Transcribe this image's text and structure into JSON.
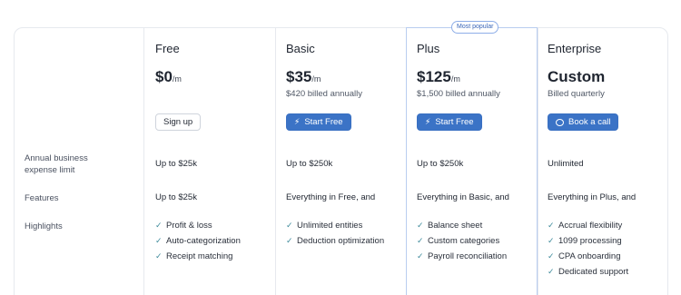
{
  "badge": "Most popular",
  "plans": [
    {
      "name": "Free",
      "price": "$0",
      "unit": "/m",
      "billed": "",
      "cta": "Sign up",
      "expense_limit": "Up to $25k",
      "features": "Up to $25k",
      "highlights": [
        "Profit & loss",
        "Auto-categorization",
        "Receipt matching"
      ]
    },
    {
      "name": "Basic",
      "price": "$35",
      "unit": "/m",
      "billed": "$420 billed annually",
      "cta": "Start Free",
      "expense_limit": "Up to $250k",
      "features": "Everything in Free, and",
      "highlights": [
        "Unlimited entities",
        "Deduction optimization"
      ]
    },
    {
      "name": "Plus",
      "price": "$125",
      "unit": "/m",
      "billed": "$1,500 billed annually",
      "cta": "Start Free",
      "expense_limit": "Up to $250k",
      "features": "Everything in Basic, and",
      "highlights": [
        "Balance sheet",
        "Custom categories",
        "Payroll reconciliation"
      ]
    },
    {
      "name": "Enterprise",
      "price": "Custom",
      "unit": "",
      "billed": "Billed quarterly",
      "cta": "Book a call",
      "expense_limit": "Unlimited",
      "features": "Everything in Plus, and",
      "highlights": [
        "Accrual flexibility",
        "1099 processing",
        "CPA onboarding",
        "Dedicated support"
      ]
    }
  ],
  "rows": {
    "expense_limit": "Annual business expense limit",
    "features": "Features",
    "highlights": "Highlights"
  },
  "icons": {
    "check": "check-icon",
    "bolt": "bolt-icon",
    "chat": "chat-bubble-icon"
  },
  "colors": {
    "accent": "#3b73c6",
    "check": "#3d8a9b",
    "highlight_border": "#b9cdf0"
  }
}
